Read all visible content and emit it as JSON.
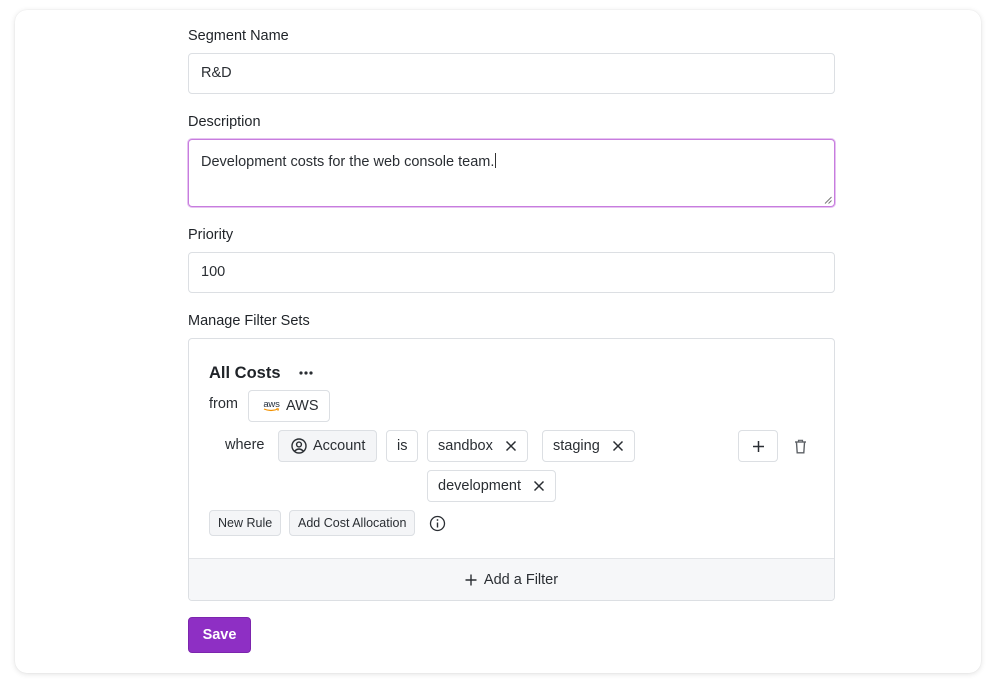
{
  "form": {
    "segment_name": {
      "label": "Segment Name",
      "value": "R&D"
    },
    "description": {
      "label": "Description",
      "value": "Development costs for the web console team."
    },
    "priority": {
      "label": "Priority",
      "value": "100"
    },
    "filter_sets_label": "Manage Filter Sets",
    "save_label": "Save"
  },
  "filter_set": {
    "title": "All Costs",
    "from_label": "from",
    "provider_logo_text": "aws",
    "provider": "AWS",
    "where_label": "where",
    "dimension": "Account",
    "operator": "is",
    "values": [
      "sandbox",
      "staging",
      "development"
    ],
    "new_rule_label": "New Rule",
    "add_cost_allocation_label": "Add Cost Allocation",
    "add_filter_label": "Add a Filter"
  },
  "colors": {
    "accent": "#8e2fc4",
    "focus_border": "#c77dde"
  },
  "icons": [
    "more-horizontal-icon",
    "aws-logo",
    "user-circle-icon",
    "close-icon",
    "plus-icon",
    "trash-icon",
    "info-icon",
    "resize-grip-icon"
  ]
}
